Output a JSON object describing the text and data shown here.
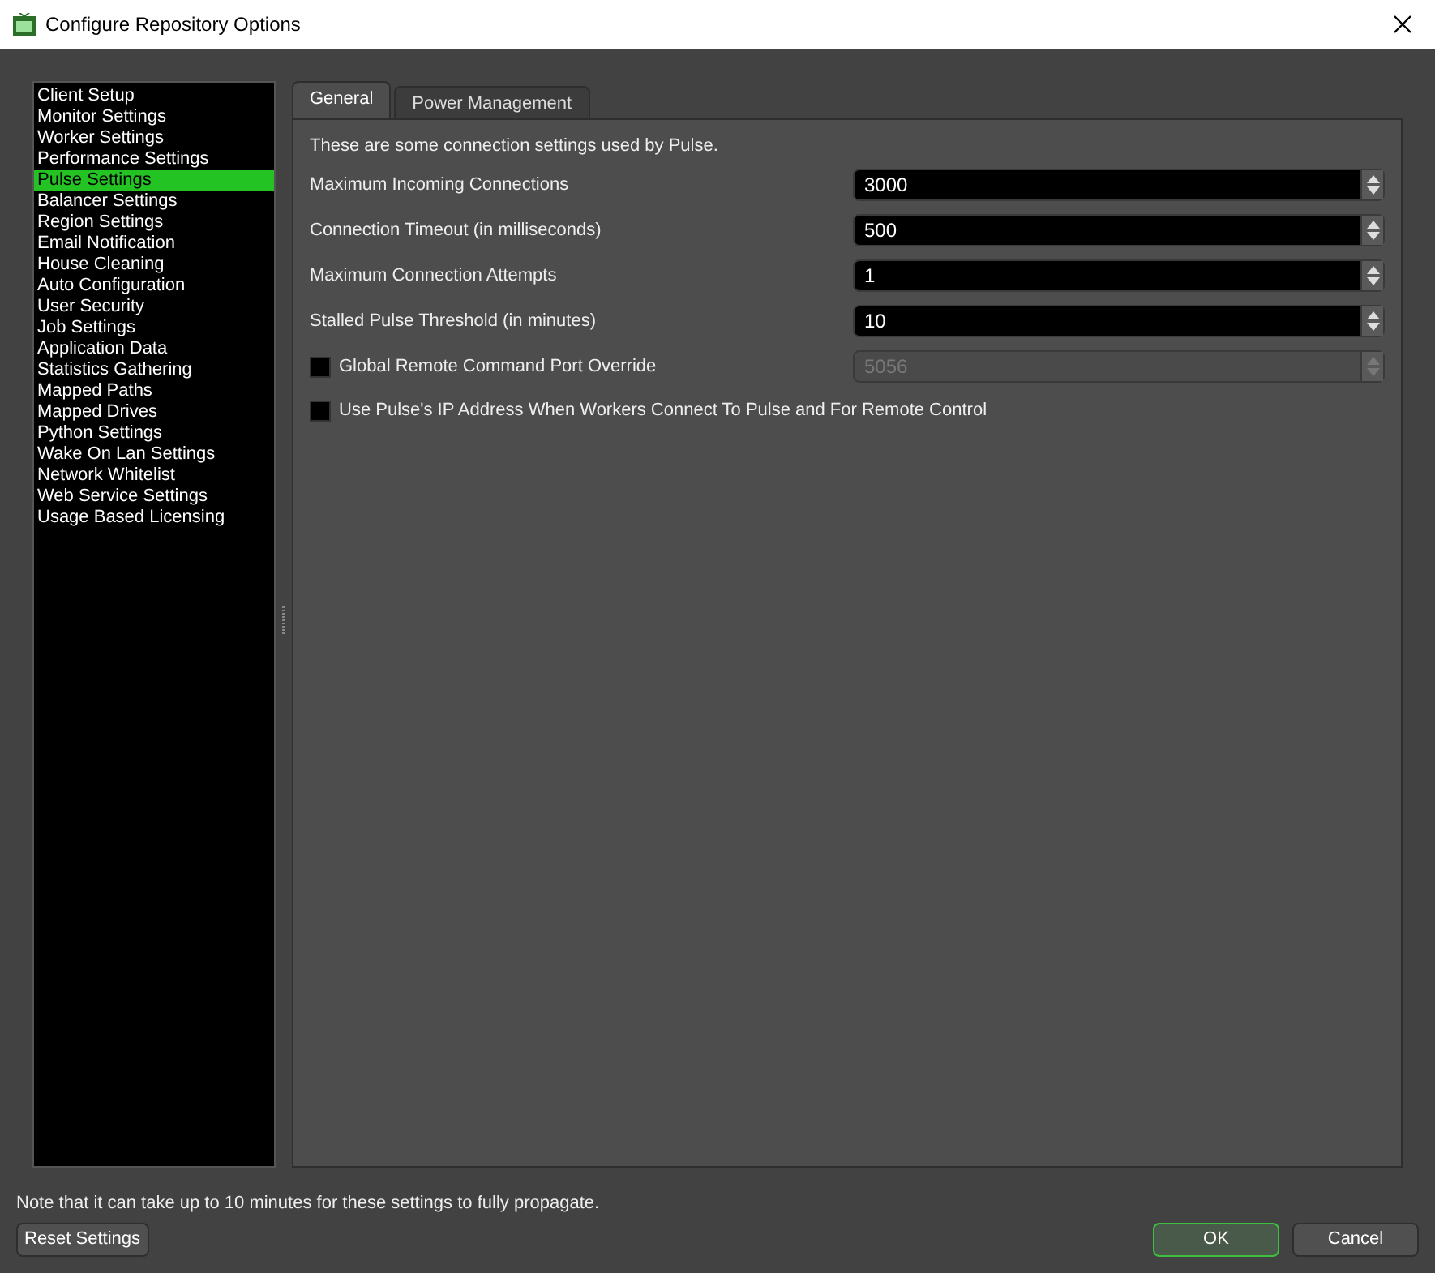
{
  "window": {
    "title": "Configure Repository Options"
  },
  "sidebar": {
    "items": [
      {
        "label": "Client Setup",
        "selected": false
      },
      {
        "label": "Monitor Settings",
        "selected": false
      },
      {
        "label": "Worker Settings",
        "selected": false
      },
      {
        "label": "Performance Settings",
        "selected": false
      },
      {
        "label": "Pulse Settings",
        "selected": true
      },
      {
        "label": "Balancer Settings",
        "selected": false
      },
      {
        "label": "Region Settings",
        "selected": false
      },
      {
        "label": "Email Notification",
        "selected": false
      },
      {
        "label": "House Cleaning",
        "selected": false
      },
      {
        "label": "Auto Configuration",
        "selected": false
      },
      {
        "label": "User Security",
        "selected": false
      },
      {
        "label": "Job Settings",
        "selected": false
      },
      {
        "label": "Application Data",
        "selected": false
      },
      {
        "label": "Statistics Gathering",
        "selected": false
      },
      {
        "label": "Mapped Paths",
        "selected": false
      },
      {
        "label": "Mapped Drives",
        "selected": false
      },
      {
        "label": "Python Settings",
        "selected": false
      },
      {
        "label": "Wake On Lan Settings",
        "selected": false
      },
      {
        "label": "Network Whitelist",
        "selected": false
      },
      {
        "label": "Web Service Settings",
        "selected": false
      },
      {
        "label": "Usage Based Licensing",
        "selected": false
      }
    ]
  },
  "tabs": [
    {
      "label": "General",
      "selected": true
    },
    {
      "label": "Power Management",
      "selected": false
    }
  ],
  "description": "These are some connection settings used by Pulse.",
  "settings": [
    {
      "kind": "spin",
      "label": "Maximum Incoming Connections",
      "value": "3000",
      "disabled": false
    },
    {
      "kind": "spin",
      "label": "Connection Timeout (in milliseconds)",
      "value": "500",
      "disabled": false
    },
    {
      "kind": "spin",
      "label": "Maximum Connection Attempts",
      "value": "1",
      "disabled": false
    },
    {
      "kind": "spin",
      "label": "Stalled Pulse Threshold (in minutes)",
      "value": "10",
      "disabled": false
    },
    {
      "kind": "checkspin",
      "label": "Global Remote Command Port Override",
      "checked": false,
      "value": "5056",
      "disabled": true
    },
    {
      "kind": "check",
      "label": "Use Pulse's IP Address When Workers Connect To Pulse and For Remote Control",
      "checked": false
    }
  ],
  "note": "Note that it can take up to 10 minutes for these settings to fully propagate.",
  "buttons": [
    {
      "label": "Reset Settings",
      "default": false
    },
    {
      "label": "OK",
      "default": true
    },
    {
      "label": "Cancel",
      "default": false
    }
  ]
}
